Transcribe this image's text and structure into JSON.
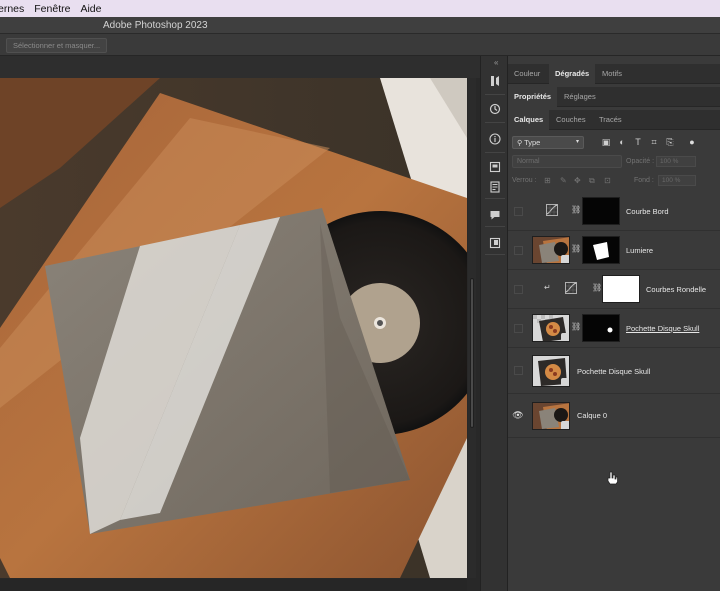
{
  "menubar": {
    "items": [
      "ernes",
      "Fenêtre",
      "Aide"
    ]
  },
  "titlebar": {
    "title": "Adobe Photoshop 2023"
  },
  "optionsbar": {
    "select_mask_label": "Sélectionner et masquer..."
  },
  "panel_tabs_row1": [
    "Couleur",
    "Dégradés",
    "Motifs"
  ],
  "panel_tabs_row2": [
    "Propriétés",
    "Réglages"
  ],
  "panel_tabs_row3": [
    "Calques",
    "Couches",
    "Tracés"
  ],
  "layers_panel": {
    "filter_type": "Type",
    "blend_mode": "Normal",
    "opacity_label": "Opacité :",
    "opacity_value": "100 %",
    "lock_label": "Verrou :",
    "fill_label": "Fond :",
    "fill_value": "100 %",
    "layers": [
      {
        "name": "Courbe Bord",
        "visible": false,
        "kind": "adjustment-curves-with-mask"
      },
      {
        "name": "Lumiere",
        "visible": false,
        "kind": "smart-with-mask"
      },
      {
        "name": "Courbes Rondelle",
        "visible": false,
        "kind": "clipped-curves-with-mask"
      },
      {
        "name": "Pochette Disque Skull",
        "visible": false,
        "kind": "smart-with-mask",
        "underlined": true
      },
      {
        "name": "Pochette Disque Skull",
        "visible": false,
        "kind": "smart"
      },
      {
        "name": "Calque 0",
        "visible": true,
        "kind": "smart"
      }
    ]
  },
  "colors": {
    "panel_bg": "#3a3a3a",
    "menubar_bg": "#e9dff0",
    "active_tab": "#e8e8e8"
  }
}
